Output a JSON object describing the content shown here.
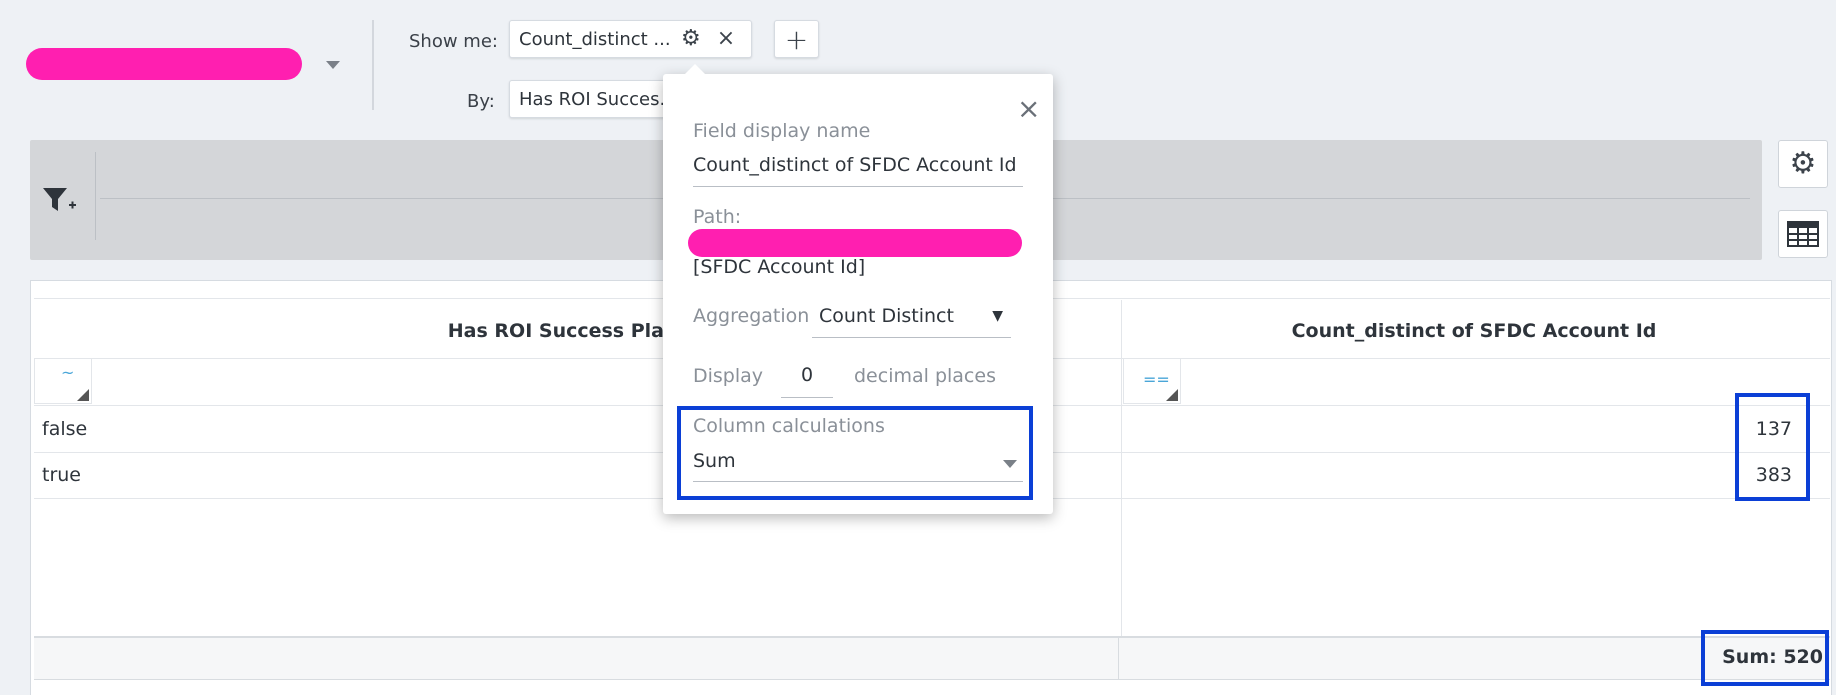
{
  "header": {
    "show_me_label": "Show me:",
    "by_label": "By:",
    "measure_pill": "Count_distinct ...",
    "group_pill": "Has ROI Succes..",
    "add_label": "+"
  },
  "table": {
    "col1_header": "Has ROI Success Pla",
    "col2_header": "Count_distinct of SFDC Account Id",
    "col1_filter_symbol": "~",
    "col2_filter_symbol": "==",
    "rows": [
      {
        "label": "false",
        "value": "137"
      },
      {
        "label": "true",
        "value": "383"
      }
    ],
    "footer": "Sum: 520"
  },
  "popover": {
    "display_name_label": "Field display name",
    "display_name_value": "Count_distinct of SFDC Account Id",
    "path_label": "Path:",
    "path_value": "[SFDC Account Id]",
    "aggregation_label": "Aggregation",
    "aggregation_value": "Count Distinct",
    "display_label": "Display",
    "decimal_value": "0",
    "decimal_suffix": "decimal places",
    "column_calc_label": "Column calculations",
    "column_calc_value": "Sum",
    "close_symbol": "×"
  },
  "icons": {
    "gear": "gear-icon",
    "close": "close-icon",
    "filter": "filter-add-icon",
    "table": "table-icon"
  },
  "colors": {
    "highlight": "#0b3fd6",
    "redaction": "#ff1fb0",
    "filter_symbol": "#4aa6d8"
  }
}
